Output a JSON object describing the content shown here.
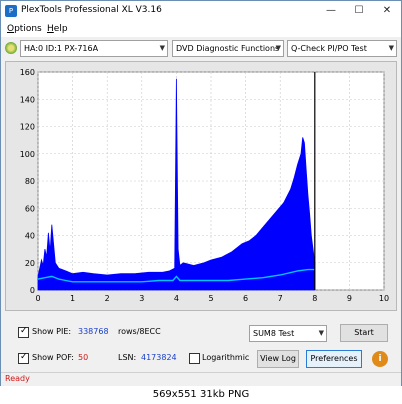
{
  "window": {
    "title": "PlexTools Professional XL V3.16",
    "app_icon_glyph": "P",
    "minimize_glyph": "—",
    "maximize_glyph": "☐",
    "close_glyph": "✕"
  },
  "menu": {
    "options_ul": "O",
    "options_rest": "ptions",
    "help_ul": "H",
    "help_rest": "elp"
  },
  "toolbar": {
    "drive": "HA:0 ID:1  PX-716A",
    "function": "DVD Diagnostic Functions",
    "test": "Q-Check PI/PO Test",
    "arrow_glyph": "▼"
  },
  "controls": {
    "show_pie_label": "Show PIE:",
    "pie_value": "338768",
    "pie_unit": "rows/8ECC",
    "show_pof_label": "Show POF:",
    "pof_value": "50",
    "lsn_label": "LSN:",
    "lsn_value": "4173824",
    "logarithmic_label": "Logarithmic",
    "sum_select": "SUM8 Test",
    "start_button": "Start",
    "view_log_button": "View Log",
    "preferences_button": "Preferences",
    "info_glyph": "i",
    "show_pie_checked": true,
    "show_pof_checked": true,
    "logarithmic_checked": false
  },
  "status": {
    "text": "Ready"
  },
  "caption": "569x551  31kb  PNG",
  "colors": {
    "pie_bars": "#0000ff",
    "avg_line": "#00c8ff",
    "pof": "#ff0000",
    "marker": "#000000",
    "plot_bg": "#ffffff"
  },
  "chart_data": {
    "type": "area",
    "x_ticks": [
      "0",
      "1",
      "2",
      "3",
      "4",
      "5",
      "6",
      "7",
      "8",
      "9",
      "10"
    ],
    "y_ticks": [
      "0",
      "20",
      "40",
      "60",
      "80",
      "100",
      "120",
      "140",
      "160"
    ],
    "xlim": [
      0,
      10
    ],
    "ylim": [
      0,
      160
    ],
    "grid": true,
    "end_marker_x": 8.0,
    "series": [
      {
        "key": "pie",
        "x": [
          0.0,
          0.1,
          0.15,
          0.2,
          0.25,
          0.3,
          0.35,
          0.4,
          0.5,
          0.6,
          0.8,
          1.0,
          1.3,
          1.6,
          2.0,
          2.4,
          2.8,
          3.2,
          3.6,
          3.8,
          3.95,
          4.0,
          4.05,
          4.1,
          4.2,
          4.5,
          4.8,
          5.0,
          5.3,
          5.6,
          5.9,
          6.1,
          6.3,
          6.5,
          6.7,
          6.9,
          7.1,
          7.3,
          7.4,
          7.5,
          7.6,
          7.65,
          7.7,
          7.75,
          7.8,
          7.85,
          7.9,
          8.0
        ],
        "y": [
          10,
          22,
          18,
          30,
          24,
          42,
          28,
          48,
          20,
          16,
          14,
          12,
          13,
          12,
          11,
          12,
          12,
          13,
          13,
          14,
          16,
          155,
          30,
          18,
          20,
          18,
          20,
          22,
          24,
          28,
          34,
          36,
          40,
          46,
          52,
          58,
          64,
          74,
          82,
          92,
          100,
          112,
          108,
          88,
          70,
          56,
          40,
          20
        ]
      },
      {
        "key": "avg",
        "x": [
          0.0,
          0.2,
          0.4,
          0.6,
          0.8,
          1.0,
          1.5,
          2.0,
          2.5,
          3.0,
          3.5,
          3.9,
          4.0,
          4.1,
          4.5,
          5.0,
          5.5,
          6.0,
          6.5,
          7.0,
          7.5,
          7.8,
          8.0
        ],
        "y": [
          8,
          9,
          10,
          8,
          7,
          6,
          6,
          6,
          6,
          6,
          7,
          7,
          10,
          7,
          7,
          7,
          7,
          8,
          9,
          11,
          14,
          15,
          15
        ]
      }
    ]
  }
}
